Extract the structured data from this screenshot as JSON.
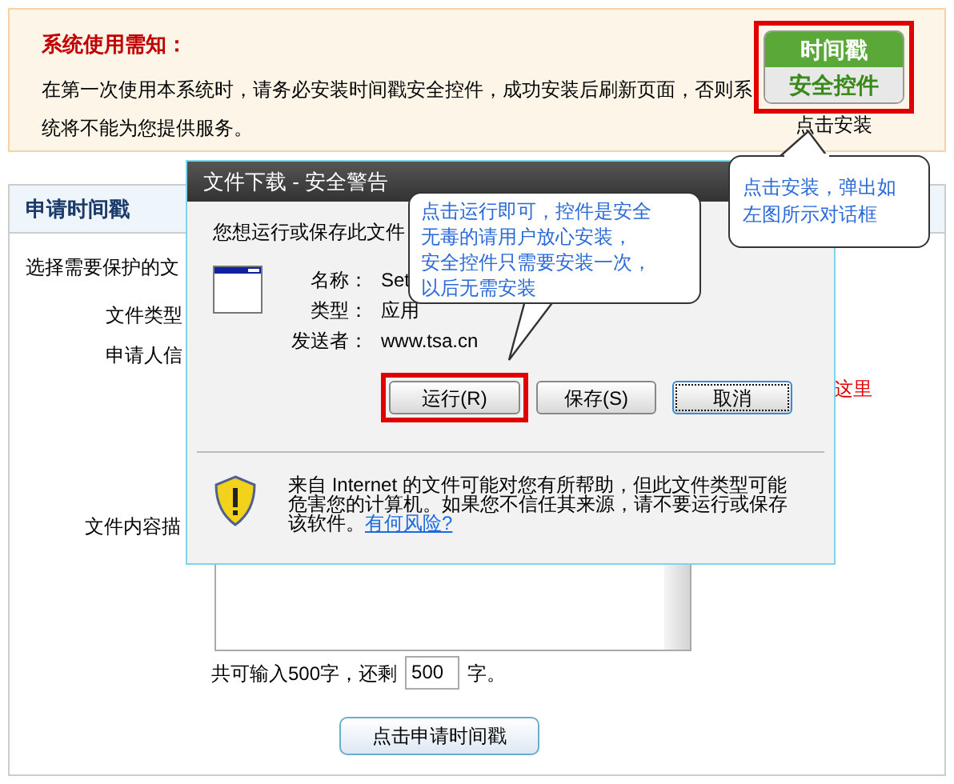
{
  "notice": {
    "title": "系统使用需知：",
    "text": "在第一次使用本系统时，请务必安装时间戳安全控件，成功安装后刷新页面，否则系统将不能为您提供服务。",
    "badge_top": "时间戳",
    "badge_bottom": "安全控件",
    "badge_caption": "点击安装",
    "highlighted": true
  },
  "panel": {
    "title": "申请时间戳",
    "labels": [
      "选择需要保护的文",
      "文件类型",
      "申请人信",
      "文件内容描"
    ],
    "red_note": "这里",
    "counter_before": "共可输入500字，还剩",
    "counter_value": "500",
    "counter_after": "字。",
    "submit": "点击申请时间戳"
  },
  "dialog": {
    "title": "文件下载 - 安全警告",
    "question": "您想运行或保存此文件",
    "fields": [
      {
        "label": "名称：",
        "value": "Set"
      },
      {
        "label": "类型：",
        "value": "应用"
      },
      {
        "label": "发送者：",
        "value": "www.tsa.cn"
      }
    ],
    "buttons": [
      {
        "label": "运行(R)",
        "highlighted": true,
        "focused": false
      },
      {
        "label": "保存(S)",
        "highlighted": false,
        "focused": false
      },
      {
        "label": "取消",
        "highlighted": false,
        "focused": true
      }
    ],
    "warning": "来自 Internet 的文件可能对您有所帮助，但此文件类型可能危害您的计算机。如果您不信任其来源，请不要运行或保存该软件。",
    "warning_link": "有何风险?"
  },
  "callouts": [
    {
      "lines": [
        "点击运行即可，控件是安全",
        "无毒的请用户放心安装，",
        "安全控件只需要安装一次，",
        "以后无需安装"
      ]
    },
    {
      "lines": [
        "点击安装，弹出如",
        "左图所示对话框"
      ]
    }
  ]
}
